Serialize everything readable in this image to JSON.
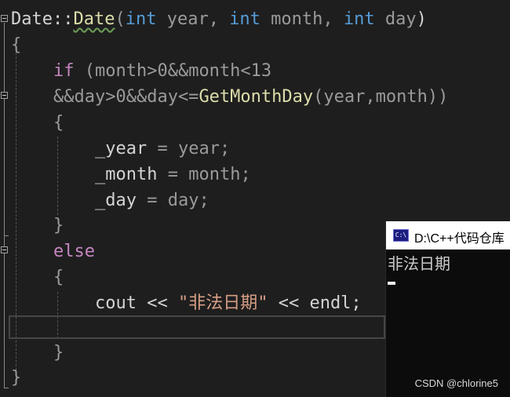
{
  "editor": {
    "line1": {
      "class_name": "Date",
      "scope": "::",
      "func_name": "Date",
      "p_open": "(",
      "kw1": "int",
      "a1": " year, ",
      "kw2": "int",
      "a2": " month, ",
      "kw3": "int",
      "a3": " day",
      "p_close": ")"
    },
    "line2": {
      "brace": "{"
    },
    "line3": {
      "kw": "if",
      "rest": " (month>0&&month<13"
    },
    "line4": {
      "pre": "&&day>0&&day<=",
      "fn": "GetMonthDay",
      "args": "(year,month))"
    },
    "line5": {
      "brace": "{"
    },
    "line6": {
      "lhs": "_year",
      "eq": " = ",
      "rhs": "year;"
    },
    "line7": {
      "lhs": "_month",
      "eq": " = ",
      "rhs": "month;"
    },
    "line8": {
      "lhs": "_day",
      "eq": " = ",
      "rhs": "day;"
    },
    "line9": {
      "brace": "}"
    },
    "line10": {
      "kw": "else"
    },
    "line11": {
      "brace": "{"
    },
    "line12": {
      "cout": "cout << ",
      "str": "\"非法日期\"",
      "endl": " << endl;"
    },
    "line14": {
      "brace": "}"
    },
    "line15": {
      "brace": "}"
    }
  },
  "console": {
    "title": "D:\\C++代码仓库",
    "icon_label": "C:\\",
    "output": "非法日期"
  },
  "watermark": "CSDN @chlorine5",
  "colors": {
    "background": "#1e1e1e",
    "keyword": "#569cd6",
    "control_keyword": "#c586c0",
    "function": "#dcdcaa",
    "string": "#d69d85"
  }
}
